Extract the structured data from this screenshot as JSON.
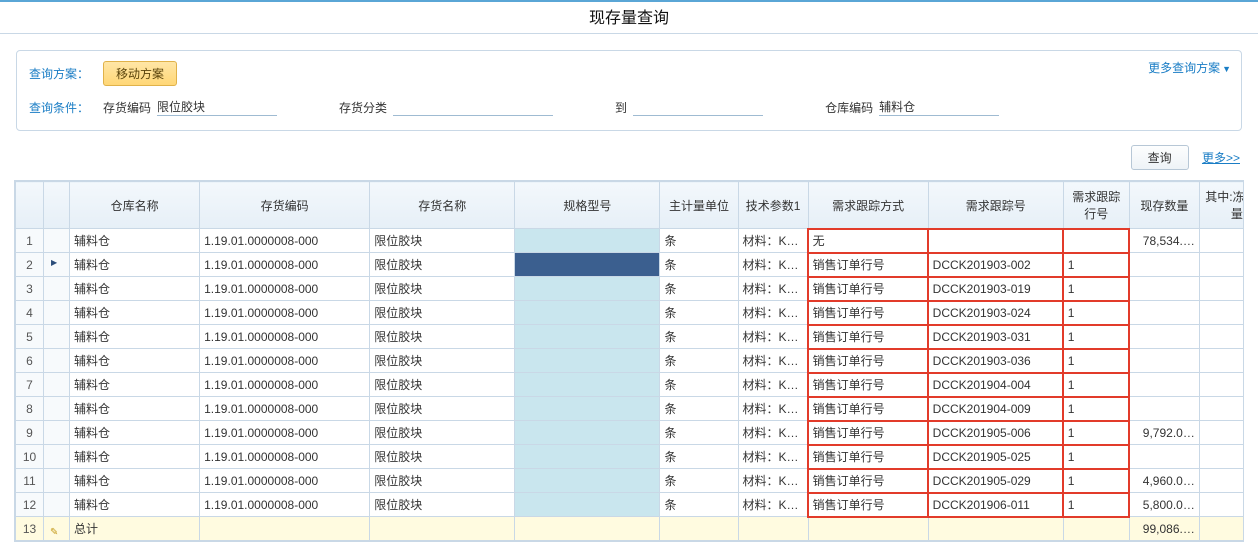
{
  "page_title": "现存量查询",
  "filter": {
    "plan_label": "查询方案：",
    "plan_button": "移动方案",
    "more_plans": "更多查询方案",
    "cond_label": "查询条件：",
    "f1_k": "存货编码",
    "f1_v": "限位胶块",
    "f2_k": "存货分类",
    "f2_v": "",
    "f3_k": "到",
    "f3_v": "",
    "f4_k": "仓库编码",
    "f4_v": "辅料仓"
  },
  "actions": {
    "query_btn": "查询",
    "more_link": "更多>>"
  },
  "columns": {
    "c0": "仓库名称",
    "c1": "存货编码",
    "c2": "存货名称",
    "c3": "规格型号",
    "c4": "主计量单位",
    "c5": "技术参数1",
    "c6": "需求跟踪方式",
    "c7": "需求跟踪号",
    "c8": "需求跟踪行号",
    "c9": "现存数量",
    "c10": "其中:冻结数量"
  },
  "rows": [
    {
      "n": "1",
      "wh": "辅料仓",
      "code": "1.19.01.0000008-000",
      "name": "限位胶块",
      "unit": "条",
      "tech": "材料：K…",
      "track_mode": "无",
      "track_no": "",
      "track_line": "",
      "qty": "78,534.…"
    },
    {
      "n": "2",
      "wh": "辅料仓",
      "code": "1.19.01.0000008-000",
      "name": "限位胶块",
      "unit": "条",
      "tech": "材料：K…",
      "track_mode": "销售订单行号",
      "track_no": "DCCK201903-002",
      "track_line": "1",
      "qty": ""
    },
    {
      "n": "3",
      "wh": "辅料仓",
      "code": "1.19.01.0000008-000",
      "name": "限位胶块",
      "unit": "条",
      "tech": "材料：K…",
      "track_mode": "销售订单行号",
      "track_no": "DCCK201903-019",
      "track_line": "1",
      "qty": ""
    },
    {
      "n": "4",
      "wh": "辅料仓",
      "code": "1.19.01.0000008-000",
      "name": "限位胶块",
      "unit": "条",
      "tech": "材料：K…",
      "track_mode": "销售订单行号",
      "track_no": "DCCK201903-024",
      "track_line": "1",
      "qty": ""
    },
    {
      "n": "5",
      "wh": "辅料仓",
      "code": "1.19.01.0000008-000",
      "name": "限位胶块",
      "unit": "条",
      "tech": "材料：K…",
      "track_mode": "销售订单行号",
      "track_no": "DCCK201903-031",
      "track_line": "1",
      "qty": ""
    },
    {
      "n": "6",
      "wh": "辅料仓",
      "code": "1.19.01.0000008-000",
      "name": "限位胶块",
      "unit": "条",
      "tech": "材料：K…",
      "track_mode": "销售订单行号",
      "track_no": "DCCK201903-036",
      "track_line": "1",
      "qty": ""
    },
    {
      "n": "7",
      "wh": "辅料仓",
      "code": "1.19.01.0000008-000",
      "name": "限位胶块",
      "unit": "条",
      "tech": "材料：K…",
      "track_mode": "销售订单行号",
      "track_no": "DCCK201904-004",
      "track_line": "1",
      "qty": ""
    },
    {
      "n": "8",
      "wh": "辅料仓",
      "code": "1.19.01.0000008-000",
      "name": "限位胶块",
      "unit": "条",
      "tech": "材料：K…",
      "track_mode": "销售订单行号",
      "track_no": "DCCK201904-009",
      "track_line": "1",
      "qty": ""
    },
    {
      "n": "9",
      "wh": "辅料仓",
      "code": "1.19.01.0000008-000",
      "name": "限位胶块",
      "unit": "条",
      "tech": "材料：K…",
      "track_mode": "销售订单行号",
      "track_no": "DCCK201905-006",
      "track_line": "1",
      "qty": "9,792.0…"
    },
    {
      "n": "10",
      "wh": "辅料仓",
      "code": "1.19.01.0000008-000",
      "name": "限位胶块",
      "unit": "条",
      "tech": "材料：K…",
      "track_mode": "销售订单行号",
      "track_no": "DCCK201905-025",
      "track_line": "1",
      "qty": ""
    },
    {
      "n": "11",
      "wh": "辅料仓",
      "code": "1.19.01.0000008-000",
      "name": "限位胶块",
      "unit": "条",
      "tech": "材料：K…",
      "track_mode": "销售订单行号",
      "track_no": "DCCK201905-029",
      "track_line": "1",
      "qty": "4,960.0…"
    },
    {
      "n": "12",
      "wh": "辅料仓",
      "code": "1.19.01.0000008-000",
      "name": "限位胶块",
      "unit": "条",
      "tech": "材料：K…",
      "track_mode": "销售订单行号",
      "track_no": "DCCK201906-011",
      "track_line": "1",
      "qty": "5,800.0…"
    }
  ],
  "total_row": {
    "n": "13",
    "label": "总计",
    "qty": "99,086.…"
  },
  "selected_row_index": 1
}
